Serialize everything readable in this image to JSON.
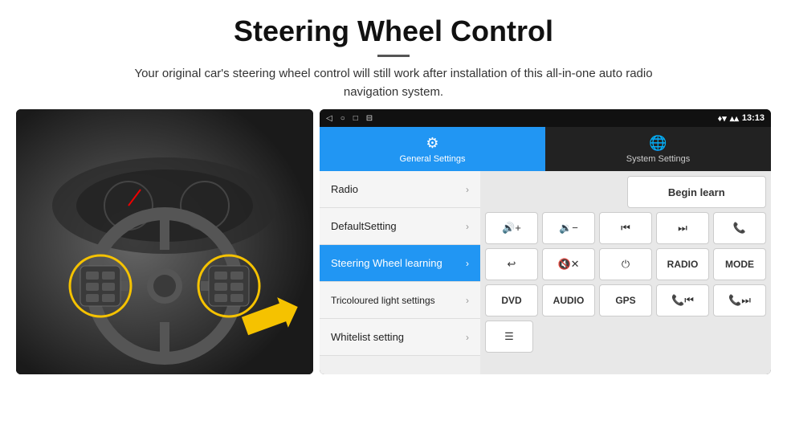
{
  "header": {
    "title": "Steering Wheel Control",
    "subtitle": "Your original car's steering wheel control will still work after installation of this all-in-one auto radio navigation system."
  },
  "status_bar": {
    "nav_back": "◁",
    "nav_home": "○",
    "nav_square": "□",
    "nav_cast": "⊟",
    "time": "13:13",
    "signal": "▾▴",
    "wifi": "▾"
  },
  "tabs": [
    {
      "id": "general",
      "label": "General Settings",
      "icon": "⚙",
      "active": true
    },
    {
      "id": "system",
      "label": "System Settings",
      "icon": "🌐",
      "active": false
    }
  ],
  "menu_items": [
    {
      "id": "radio",
      "label": "Radio",
      "active": false
    },
    {
      "id": "default",
      "label": "DefaultSetting",
      "active": false
    },
    {
      "id": "steering",
      "label": "Steering Wheel learning",
      "active": true
    },
    {
      "id": "tricoloured",
      "label": "Tricoloured light settings",
      "active": false
    },
    {
      "id": "whitelist",
      "label": "Whitelist setting",
      "active": false
    }
  ],
  "controls": {
    "begin_learn_label": "Begin learn",
    "row2": [
      {
        "id": "vol-up",
        "label": "🔊+",
        "type": "icon"
      },
      {
        "id": "vol-down",
        "label": "🔉−",
        "type": "icon"
      },
      {
        "id": "prev",
        "label": "⏮",
        "type": "icon"
      },
      {
        "id": "next",
        "label": "⏭",
        "type": "icon"
      },
      {
        "id": "phone",
        "label": "📞",
        "type": "icon"
      }
    ],
    "row3": [
      {
        "id": "hang-up",
        "label": "↩",
        "type": "icon"
      },
      {
        "id": "mute",
        "label": "🔇×",
        "type": "icon"
      },
      {
        "id": "power",
        "label": "⏻",
        "type": "icon"
      },
      {
        "id": "radio",
        "label": "RADIO",
        "type": "text"
      },
      {
        "id": "mode",
        "label": "MODE",
        "type": "text"
      }
    ],
    "row4": [
      {
        "id": "dvd",
        "label": "DVD",
        "type": "text"
      },
      {
        "id": "audio",
        "label": "AUDIO",
        "type": "text"
      },
      {
        "id": "gps",
        "label": "GPS",
        "type": "text"
      },
      {
        "id": "phone-prev",
        "label": "📞⏮",
        "type": "icon"
      },
      {
        "id": "phone-next",
        "label": "📞⏭",
        "type": "icon"
      }
    ],
    "row5": [
      {
        "id": "list",
        "label": "☰",
        "type": "icon"
      }
    ]
  }
}
